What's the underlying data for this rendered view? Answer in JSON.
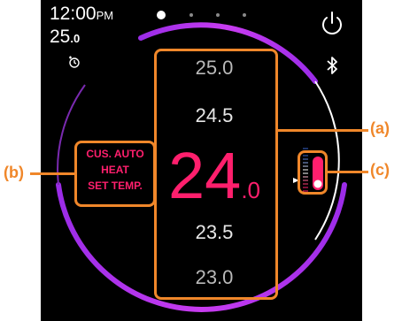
{
  "status": {
    "time": "12:00",
    "ampm": "PM",
    "setpoint_int": "25",
    "setpoint_dec": ".0"
  },
  "pager": {
    "count": 4,
    "active_index": 0
  },
  "icons": {
    "timer": "timer-icon",
    "power": "power-icon",
    "bluetooth": "bluetooth-icon"
  },
  "temperature_wheel": {
    "values": [
      "25.0",
      "24.5",
      "23.5",
      "23.0"
    ],
    "current_int": "24",
    "current_dec": ".0"
  },
  "mode_label": {
    "line1": "CUS. AUTO",
    "line2": "HEAT",
    "line3": "SET TEMP."
  },
  "callouts": {
    "a": "(a)",
    "b": "(b)",
    "c": "(c)"
  },
  "colors": {
    "background": "#000000",
    "accent": "#ff1f6d",
    "ring": "#c23cf0",
    "callout": "#f0872a",
    "gauge_blue": "#3a63c9"
  }
}
